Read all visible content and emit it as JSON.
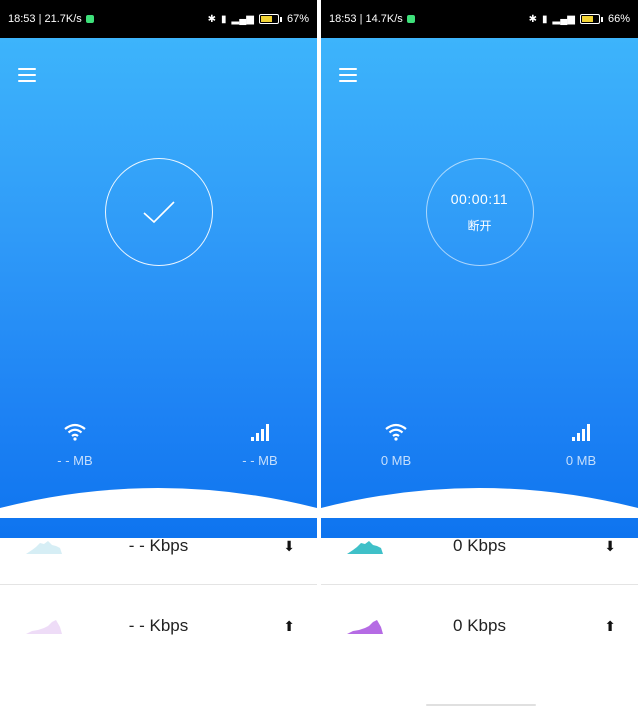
{
  "screens": [
    {
      "status": {
        "time_speed": "18:53 | 21.7K/s",
        "battery": "67%"
      },
      "circle_state": "connected",
      "wifi_usage": "- - MB",
      "cell_usage": "- - MB",
      "download": {
        "speed": "- - Kbps",
        "arrow": "⬇"
      },
      "upload": {
        "speed": "- - Kbps",
        "arrow": "⬆"
      },
      "spark_download_color": "#d6eef5",
      "spark_upload_color": "#eedcf7"
    },
    {
      "status": {
        "time_speed": "18:53 | 14.7K/s",
        "battery": "66%"
      },
      "circle_state": "timer",
      "timer": "00:00:11",
      "disconnect_label": "断开",
      "wifi_usage": "0 MB",
      "cell_usage": "0 MB",
      "download": {
        "speed": "0 Kbps",
        "arrow": "⬇"
      },
      "upload": {
        "speed": "0 Kbps",
        "arrow": "⬆"
      },
      "spark_download_color": "#3fc0c8",
      "spark_upload_color": "#b56be4"
    }
  ],
  "icons": {
    "menu": "menu-icon",
    "check": "check-icon",
    "wifi": "wifi-icon",
    "signal": "signal-icon",
    "bluetooth": "bluetooth-icon",
    "vibrate": "vibrate-icon",
    "battery": "battery-icon"
  },
  "colors": {
    "hero_top": "#3db4fb",
    "hero_bottom": "#0e74ef"
  }
}
